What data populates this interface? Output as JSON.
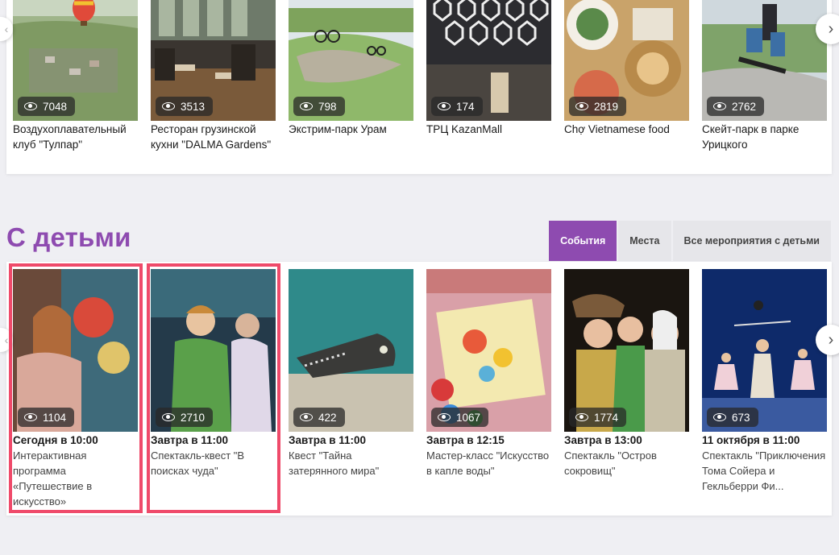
{
  "places": [
    {
      "views": "7048",
      "title_l1": "Воздухоплавательный",
      "title_l2": "клуб \"Тулпар\""
    },
    {
      "views": "3513",
      "title_l1": "Ресторан грузинской",
      "title_l2": "кухни \"DALMA Gardens\""
    },
    {
      "views": "798",
      "title_l1": "Экстрим-парк Урам",
      "title_l2": ""
    },
    {
      "views": "174",
      "title_l1": "ТРЦ KazanMall",
      "title_l2": ""
    },
    {
      "views": "2819",
      "title_l1": "Chợ Vietnamese food",
      "title_l2": ""
    },
    {
      "views": "2762",
      "title_l1": "Скейт-парк в парке",
      "title_l2": "Урицкого"
    }
  ],
  "kids": {
    "title": "С детьми",
    "tabs": [
      "События",
      "Места",
      "Все мероприятия с детьми"
    ],
    "events": [
      {
        "views": "1104",
        "date": "Сегодня в 10:00",
        "d1": "Интерактивная",
        "d2": "программа",
        "d3": "«Путешествие в",
        "d4": "искусство»"
      },
      {
        "views": "2710",
        "date": "Завтра в 11:00",
        "d1": "Спектакль-квест \"В",
        "d2": "поисках чуда\"",
        "d3": "",
        "d4": ""
      },
      {
        "views": "422",
        "date": "Завтра в 11:00",
        "d1": "Квест \"Тайна",
        "d2": "затерянного мира\"",
        "d3": "",
        "d4": ""
      },
      {
        "views": "1067",
        "date": "Завтра в 12:15",
        "d1": "Мастер-класс \"Искусство",
        "d2": "в капле воды\"",
        "d3": "",
        "d4": ""
      },
      {
        "views": "1774",
        "date": "Завтра в 13:00",
        "d1": "Спектакль \"Остров",
        "d2": "сокровищ\"",
        "d3": "",
        "d4": ""
      },
      {
        "views": "673",
        "date": "11 октября в 11:00",
        "d1": "Спектакль \"Приключения",
        "d2": "Тома Сойера и",
        "d3": "Гекльберри Фи...",
        "d4": ""
      }
    ]
  },
  "icons": {
    "eye": "eye-icon",
    "next": "chevron-right-icon",
    "prev": "chevron-left-icon"
  },
  "colors": {
    "accent": "#8e4bb0",
    "highlight": "#ef4a6a"
  }
}
